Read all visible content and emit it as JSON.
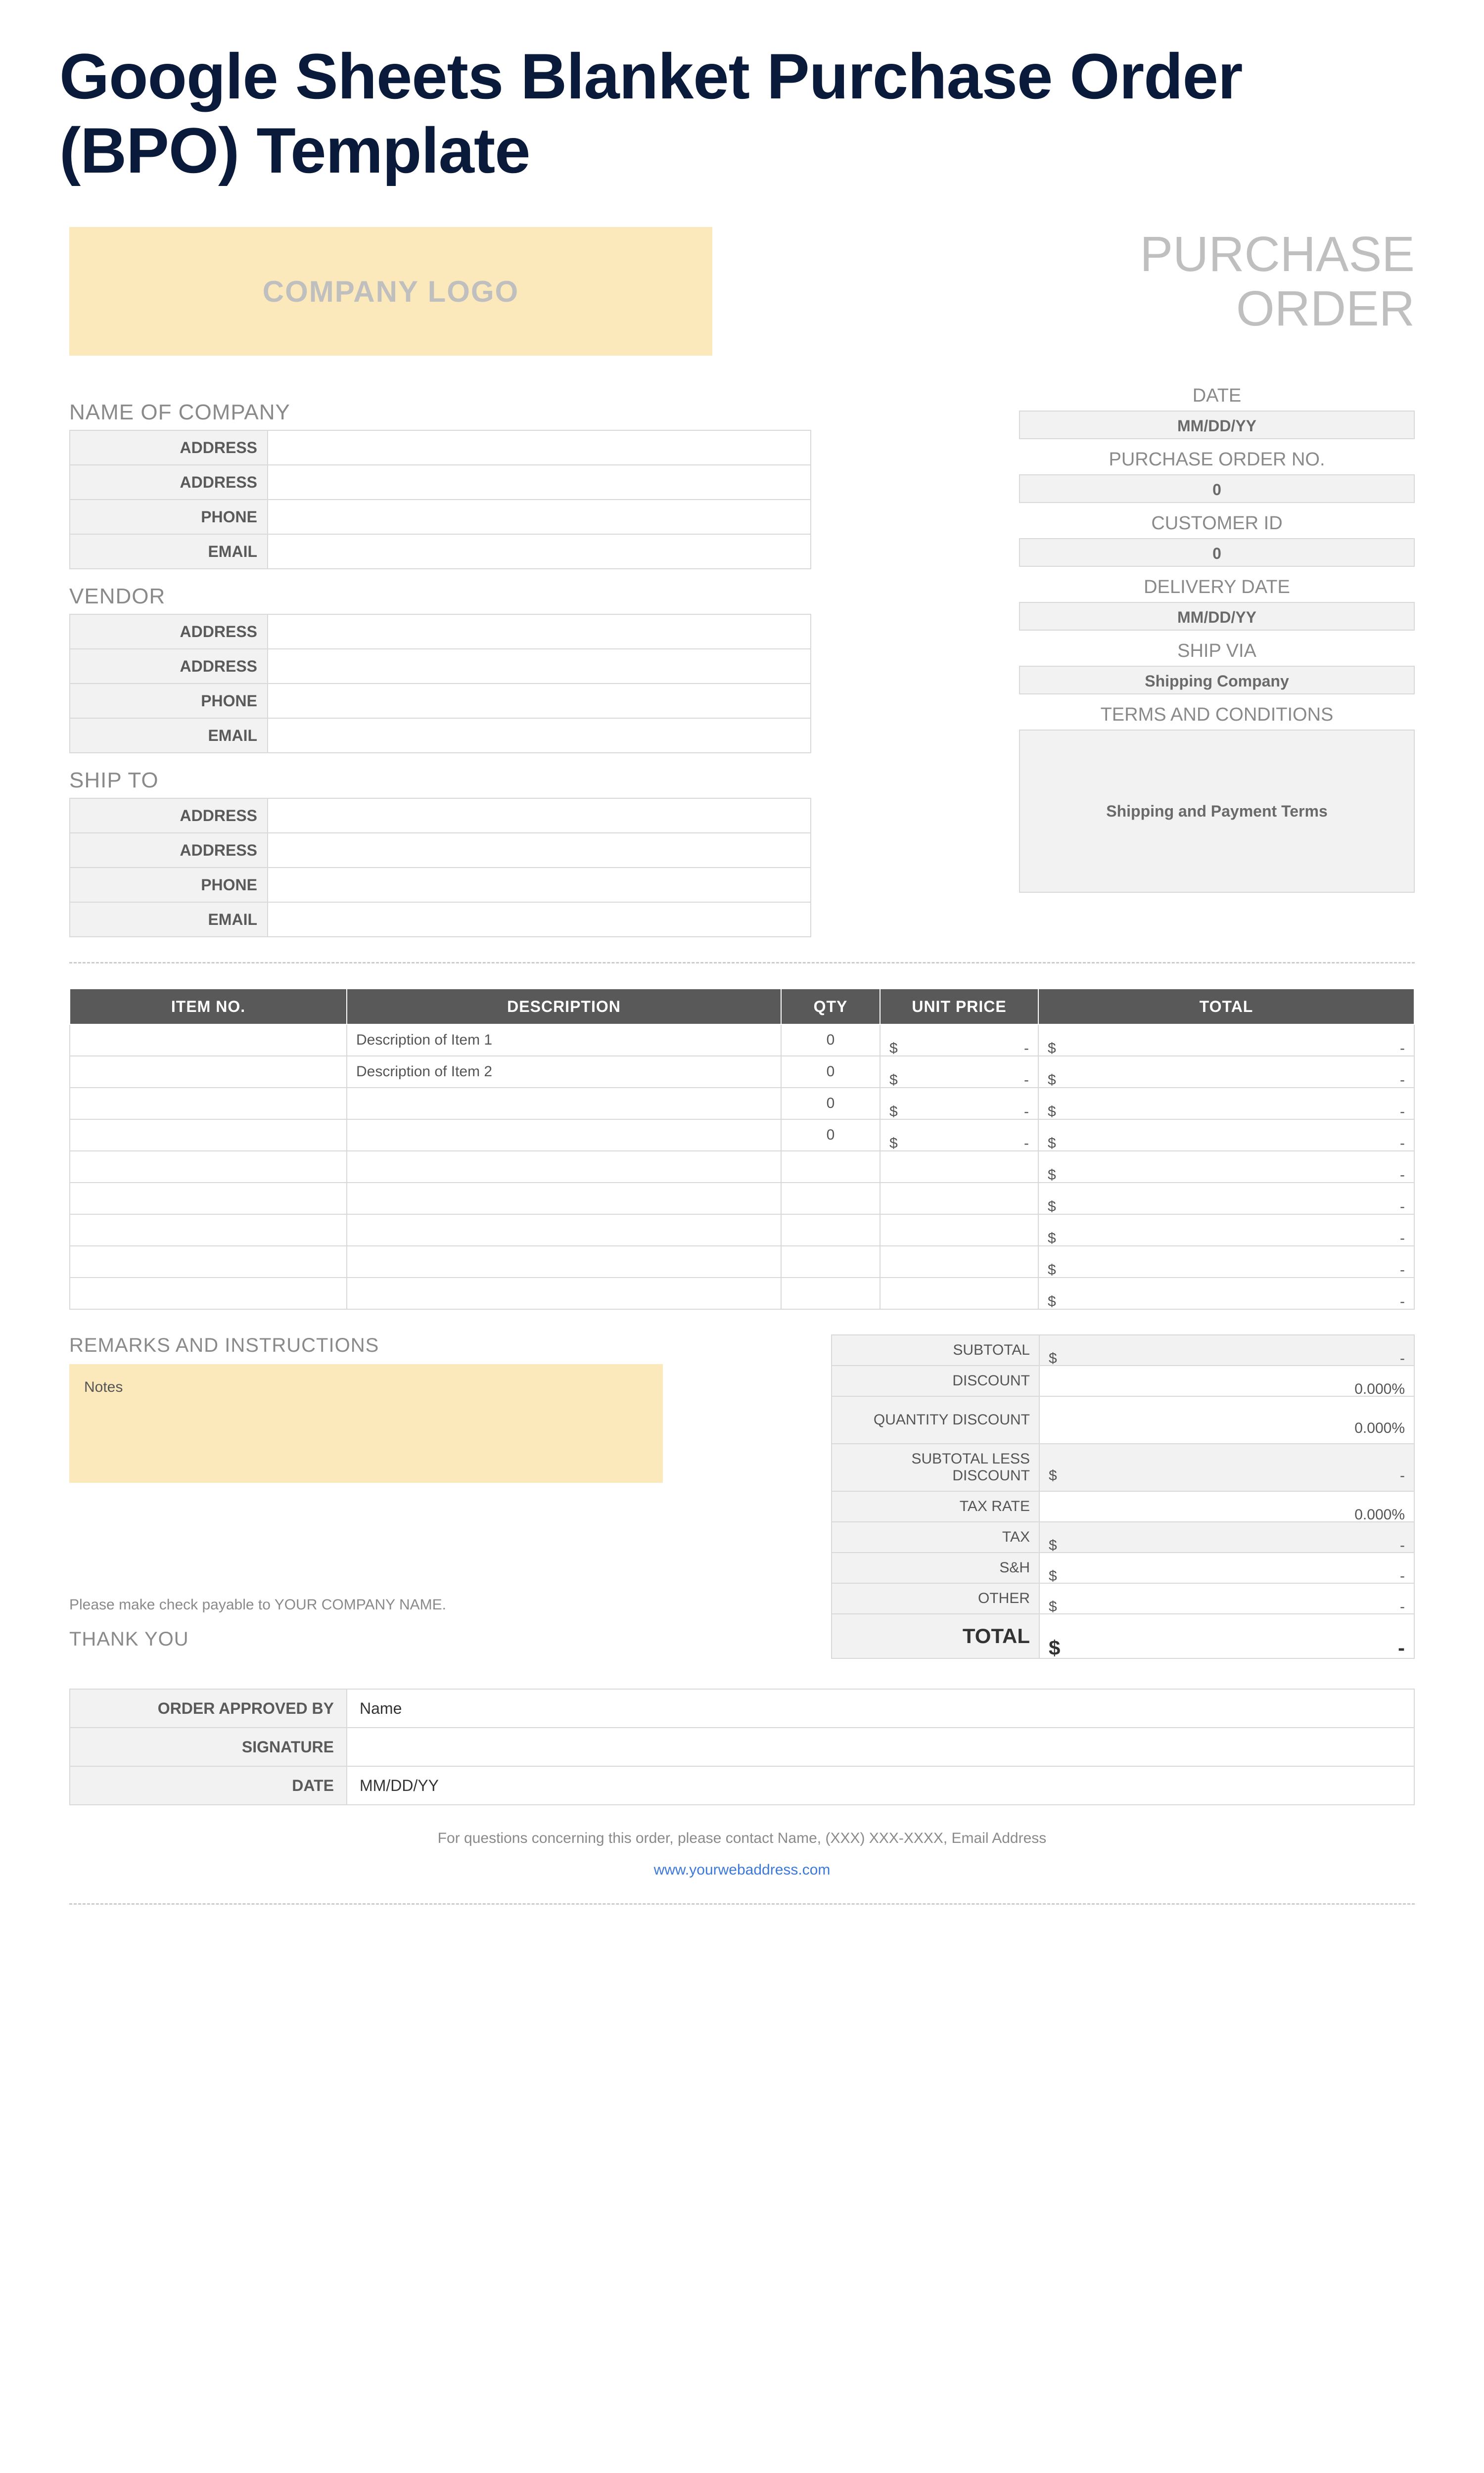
{
  "title": "Google Sheets Blanket Purchase Order (BPO) Template",
  "logo": "COMPANY LOGO",
  "po_heading": "PURCHASE ORDER",
  "company": {
    "heading": "NAME OF COMPANY",
    "rows": [
      {
        "label": "ADDRESS",
        "value": ""
      },
      {
        "label": "ADDRESS",
        "value": ""
      },
      {
        "label": "PHONE",
        "value": ""
      },
      {
        "label": "EMAIL",
        "value": ""
      }
    ]
  },
  "vendor": {
    "heading": "VENDOR",
    "rows": [
      {
        "label": "ADDRESS",
        "value": ""
      },
      {
        "label": "ADDRESS",
        "value": ""
      },
      {
        "label": "PHONE",
        "value": ""
      },
      {
        "label": "EMAIL",
        "value": ""
      }
    ]
  },
  "shipto": {
    "heading": "SHIP TO",
    "rows": [
      {
        "label": "ADDRESS",
        "value": ""
      },
      {
        "label": "ADDRESS",
        "value": ""
      },
      {
        "label": "PHONE",
        "value": ""
      },
      {
        "label": "EMAIL",
        "value": ""
      }
    ]
  },
  "meta": {
    "date": {
      "label": "DATE",
      "value": "MM/DD/YY"
    },
    "po_no": {
      "label": "PURCHASE ORDER NO.",
      "value": "0"
    },
    "customer_id": {
      "label": "CUSTOMER ID",
      "value": "0"
    },
    "delivery_date": {
      "label": "DELIVERY DATE",
      "value": "MM/DD/YY"
    },
    "ship_via": {
      "label": "SHIP VIA",
      "value": "Shipping Company"
    },
    "terms": {
      "label": "TERMS AND CONDITIONS",
      "value": "Shipping and Payment Terms"
    }
  },
  "items_header": {
    "item_no": "ITEM NO.",
    "description": "DESCRIPTION",
    "qty": "QTY",
    "unit_price": "UNIT PRICE",
    "total": "TOTAL"
  },
  "items": [
    {
      "item_no": "",
      "description": "Description of Item 1",
      "qty": "0",
      "unit_cur": "$",
      "unit_amt": "-",
      "total_cur": "$",
      "total_amt": "-"
    },
    {
      "item_no": "",
      "description": "Description of Item 2",
      "qty": "0",
      "unit_cur": "$",
      "unit_amt": "-",
      "total_cur": "$",
      "total_amt": "-"
    },
    {
      "item_no": "",
      "description": "",
      "qty": "0",
      "unit_cur": "$",
      "unit_amt": "-",
      "total_cur": "$",
      "total_amt": "-"
    },
    {
      "item_no": "",
      "description": "",
      "qty": "0",
      "unit_cur": "$",
      "unit_amt": "-",
      "total_cur": "$",
      "total_amt": "-"
    },
    {
      "item_no": "",
      "description": "",
      "qty": "",
      "unit_cur": "",
      "unit_amt": "",
      "total_cur": "$",
      "total_amt": "-"
    },
    {
      "item_no": "",
      "description": "",
      "qty": "",
      "unit_cur": "",
      "unit_amt": "",
      "total_cur": "$",
      "total_amt": "-"
    },
    {
      "item_no": "",
      "description": "",
      "qty": "",
      "unit_cur": "",
      "unit_amt": "",
      "total_cur": "$",
      "total_amt": "-"
    },
    {
      "item_no": "",
      "description": "",
      "qty": "",
      "unit_cur": "",
      "unit_amt": "",
      "total_cur": "$",
      "total_amt": "-"
    },
    {
      "item_no": "",
      "description": "",
      "qty": "",
      "unit_cur": "",
      "unit_amt": "",
      "total_cur": "$",
      "total_amt": "-"
    }
  ],
  "remarks": {
    "heading": "REMARKS AND INSTRUCTIONS",
    "notes": "Notes"
  },
  "payable": "Please make check payable to YOUR COMPANY NAME.",
  "thank": "THANK YOU",
  "totals": [
    {
      "label": "SUBTOTAL",
      "cur": "$",
      "amt": "-",
      "shade": true
    },
    {
      "label": "DISCOUNT",
      "cur": "",
      "amt": "0.000%",
      "shade": false
    },
    {
      "label": "QUANTITY DISCOUNT",
      "cur": "",
      "amt": "0.000%",
      "shade": false,
      "tall": true
    },
    {
      "label": "SUBTOTAL LESS DISCOUNT",
      "cur": "$",
      "amt": "-",
      "shade": true,
      "tall": true
    },
    {
      "label": "TAX RATE",
      "cur": "",
      "amt": "0.000%",
      "shade": false
    },
    {
      "label": "TAX",
      "cur": "$",
      "amt": "-",
      "shade": true
    },
    {
      "label": "S&H",
      "cur": "$",
      "amt": "-",
      "shade": false
    },
    {
      "label": "OTHER",
      "cur": "$",
      "amt": "-",
      "shade": false
    }
  ],
  "grand_total": {
    "label": "TOTAL",
    "cur": "$",
    "amt": "-"
  },
  "approval": {
    "rows": [
      {
        "label": "ORDER APPROVED BY",
        "value": "Name"
      },
      {
        "label": "SIGNATURE",
        "value": ""
      },
      {
        "label": "DATE",
        "value": "MM/DD/YY"
      }
    ]
  },
  "footer": {
    "question": "For questions concerning this order, please contact Name, (XXX) XXX-XXXX, Email Address",
    "link": "www.yourwebaddress.com"
  }
}
